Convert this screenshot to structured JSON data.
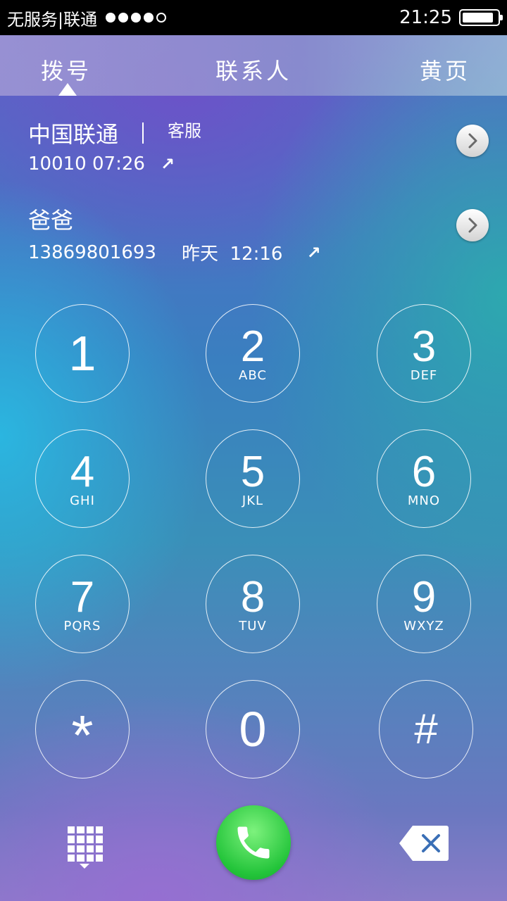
{
  "status_bar": {
    "carrier": "无服务|联通",
    "signal_filled": 4,
    "signal_total": 5,
    "time": "21:25",
    "battery_level": 0.9
  },
  "tabs": [
    {
      "label": "拨号",
      "active": true
    },
    {
      "label": "联系人",
      "active": false
    },
    {
      "label": "黄页",
      "active": false
    }
  ],
  "recents": [
    {
      "name": "中国联通",
      "tag": "客服",
      "number": "10010",
      "time": "07:26",
      "direction_icon": "outgoing-arrow-icon"
    },
    {
      "name": "爸爸",
      "tag": "",
      "number": "13869801693",
      "time": "昨天  12:16",
      "direction_icon": "outgoing-arrow-icon"
    }
  ],
  "keypad": [
    {
      "digit": "1",
      "letters": ""
    },
    {
      "digit": "2",
      "letters": "ABC"
    },
    {
      "digit": "3",
      "letters": "DEF"
    },
    {
      "digit": "4",
      "letters": "GHI"
    },
    {
      "digit": "5",
      "letters": "JKL"
    },
    {
      "digit": "6",
      "letters": "MNO"
    },
    {
      "digit": "7",
      "letters": "PQRS"
    },
    {
      "digit": "8",
      "letters": "TUV"
    },
    {
      "digit": "9",
      "letters": "WXYZ"
    },
    {
      "digit": "*",
      "letters": ""
    },
    {
      "digit": "0",
      "letters": ""
    },
    {
      "digit": "#",
      "letters": ""
    }
  ],
  "bottom_bar": {
    "left_icon": "keypad-grid-icon",
    "center_icon": "phone-call-icon",
    "call_color": "#23c43a",
    "right_icon": "backspace-icon"
  }
}
